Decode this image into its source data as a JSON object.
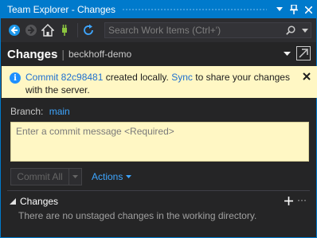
{
  "window": {
    "title": "Team Explorer - Changes"
  },
  "toolbar": {
    "search_placeholder": "Search Work Items (Ctrl+')",
    "icons": [
      "back-icon",
      "forward-icon",
      "home-icon",
      "connect-icon",
      "refresh-icon",
      "search-icon"
    ]
  },
  "header": {
    "title": "Changes",
    "divider": "|",
    "repo": "beckhoff-demo"
  },
  "infobar": {
    "link_commit": "Commit 82c98481",
    "text_1": " created locally. ",
    "link_sync": "Sync",
    "text_2": " to share your changes with the server."
  },
  "branch": {
    "label": "Branch:",
    "value": "main"
  },
  "commit": {
    "placeholder": "Enter a commit message <Required>",
    "button": "Commit All",
    "actions": "Actions"
  },
  "changes": {
    "title": "Changes",
    "empty": "There are no unstaged changes in the working directory.",
    "more": "···"
  },
  "colors": {
    "accent": "#007acc",
    "info_bg": "#fff7c4",
    "link": "#3ea6ff",
    "panel_bg": "#252526"
  }
}
